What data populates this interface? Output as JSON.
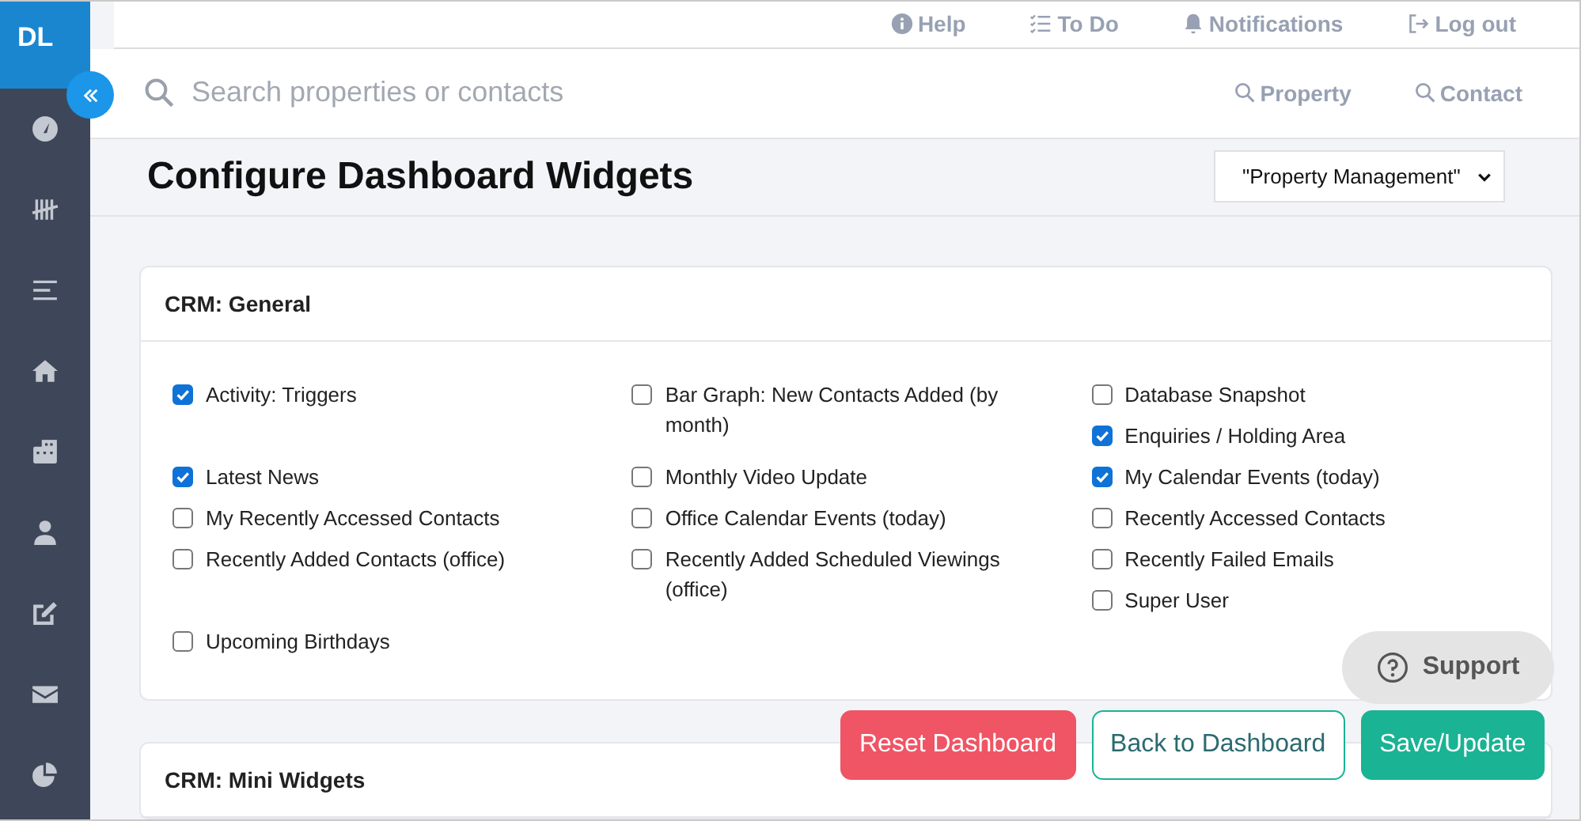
{
  "sidebar": {
    "logo": "DL"
  },
  "top_links": [
    {
      "kind": "help",
      "label": "Help"
    },
    {
      "kind": "todo",
      "label": "To Do"
    },
    {
      "kind": "bell",
      "label": "Notifications"
    },
    {
      "kind": "logout",
      "label": "Log out"
    }
  ],
  "search": {
    "placeholder": "Search properties or contacts",
    "links": [
      "Property",
      "Contact"
    ]
  },
  "page_title": "Configure Dashboard Widgets",
  "profile_select": {
    "value": "\"Property Management\""
  },
  "sections": [
    {
      "title": "CRM: General",
      "widgets": [
        {
          "label": "Activity: Triggers",
          "checked": true
        },
        {
          "label": "Bar Graph: New Contacts Added (by month)",
          "checked": false
        },
        {
          "label": "Database Snapshot",
          "checked": false
        },
        {
          "label": "Enquiries / Holding Area",
          "checked": true
        },
        {
          "label": "Latest News",
          "checked": true
        },
        {
          "label": "Monthly Video Update",
          "checked": false
        },
        {
          "label": "My Calendar Events (today)",
          "checked": true
        },
        {
          "label": "My Recently Accessed Contacts",
          "checked": false
        },
        {
          "label": "Office Calendar Events (today)",
          "checked": false
        },
        {
          "label": "Recently Accessed Contacts",
          "checked": false
        },
        {
          "label": "Recently Added Contacts (office)",
          "checked": false
        },
        {
          "label": "Recently Added Scheduled Viewings (office)",
          "checked": false
        },
        {
          "label": "Recently Failed Emails",
          "checked": false
        },
        {
          "label": "Super User",
          "checked": false
        },
        {
          "label": "Upcoming Birthdays",
          "checked": false
        }
      ]
    },
    {
      "title": "CRM: Mini Widgets"
    }
  ],
  "support": {
    "label": "Support"
  },
  "actions": [
    {
      "kind": "danger",
      "label": "Reset Dashboard"
    },
    {
      "kind": "outline",
      "label": "Back to Dashboard"
    },
    {
      "kind": "primary",
      "label": "Save/Update"
    }
  ]
}
